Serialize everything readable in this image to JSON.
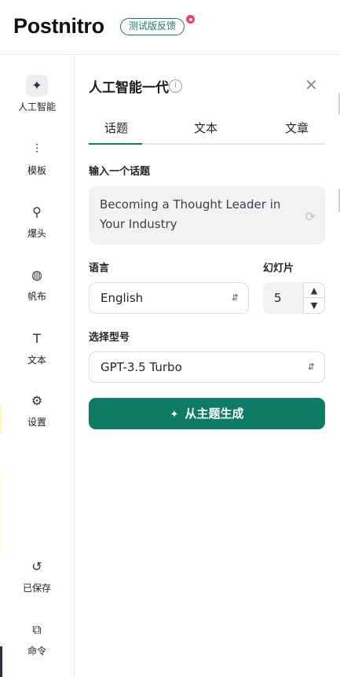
{
  "header": {
    "logo": "Postnitro",
    "beta_label": "测试版反馈"
  },
  "sidebar": {
    "items": [
      {
        "label": "人工智能",
        "icon": "sparkles-icon",
        "glyph": "✦"
      },
      {
        "label": "模板",
        "icon": "template-icon",
        "glyph": "⫶"
      },
      {
        "label": "爆头",
        "icon": "user-list-icon",
        "glyph": "⚲"
      },
      {
        "label": "帆布",
        "icon": "palette-icon",
        "glyph": "◍"
      },
      {
        "label": "文本",
        "icon": "text-icon",
        "glyph": "T"
      },
      {
        "label": "设置",
        "icon": "gear-icon",
        "glyph": "⚙"
      },
      {
        "label": "已保存",
        "icon": "history-icon",
        "glyph": "↺"
      },
      {
        "label": "命令",
        "icon": "copy-icon",
        "glyph": "⧉"
      }
    ]
  },
  "panel": {
    "title": "人工智能一代",
    "info_glyph": "i",
    "close_glyph": "✕",
    "tabs": [
      "话题",
      "文本",
      "文章"
    ],
    "topic_label": "输入一个话题",
    "topic_value": "Becoming a Thought Leader in Your Industry",
    "language_label": "语言",
    "language_value": "English",
    "slides_label": "幻灯片",
    "slides_value": "5",
    "model_label": "选择型号",
    "model_value": "GPT-3.5 Turbo",
    "generate_label": "从主题生成"
  },
  "colors": {
    "accent": "#0f7a66",
    "beta_dot": "#f43f6b",
    "input_bg": "#f1f2f4"
  }
}
